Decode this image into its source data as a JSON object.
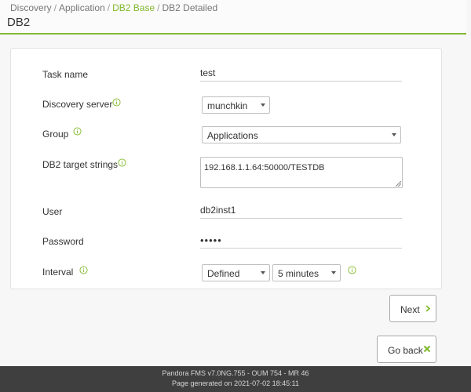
{
  "breadcrumb": {
    "items": [
      "Discovery",
      "Application",
      "DB2 Base",
      "DB2 Detailed"
    ],
    "separator": "/"
  },
  "page": {
    "title": "DB2"
  },
  "form": {
    "task_name": {
      "label": "Task name",
      "value": "test"
    },
    "discovery_server": {
      "label": "Discovery server",
      "value": "munchkin"
    },
    "group": {
      "label": "Group",
      "value": "Applications"
    },
    "db2_target_strings": {
      "label": "DB2 target strings",
      "value": "192.168.1.1.64:50000/TESTDB"
    },
    "user": {
      "label": "User",
      "value": "db2inst1"
    },
    "password": {
      "label": "Password",
      "value": "•••••"
    },
    "interval": {
      "label": "Interval",
      "mode": "Defined",
      "value": "5 minutes"
    }
  },
  "buttons": {
    "next": "Next",
    "go_back": "Go back"
  },
  "footer": {
    "line1": "Pandora FMS v7.0NG.755 - OUM 754 - MR 46",
    "line2": "Page generated on 2021-07-02 18:45:11"
  },
  "colors": {
    "accent": "#82b92e",
    "footer_bg": "#3f3f3f"
  },
  "icons": {
    "info": "info-circle-icon",
    "next": "chevron-right-icon",
    "go_back": "close-x-icon"
  }
}
